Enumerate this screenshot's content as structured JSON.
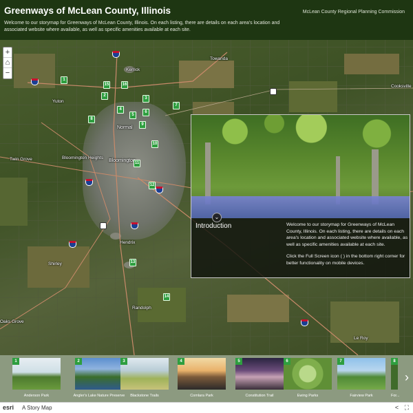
{
  "header": {
    "title": "Greenways of McLean County, Illinois",
    "description": "Welcome to our storymap for Greenways of McLean County, Illinois. On each listing, there are details on each area's location and associated website where available, as well as specific amenities available at each site.",
    "organization": "McLean County Regional Planning Commission"
  },
  "map": {
    "zoom_in": "+",
    "home": "⌂",
    "zoom_out": "−",
    "towns": [
      "Towanda",
      "Kerrick",
      "Normal",
      "Bloomington",
      "Bloomington Heights",
      "Twin Grove",
      "Yuton",
      "Hendrix",
      "Shirley",
      "Randolph",
      "Cooksville",
      "Oaks Grove",
      "Le Roy"
    ],
    "pins": [
      "1",
      "2",
      "3",
      "4",
      "5",
      "6",
      "7",
      "8",
      "9",
      "10",
      "11",
      "12",
      "13",
      "14",
      "15",
      "16"
    ]
  },
  "intro_panel": {
    "title": "Introduction",
    "paragraph1": "Welcome to our storymap for Greenways of McLean County, Illinois. On each listing, there are details on each area's location and associated website where available, as well as specific amenities available at each site.",
    "paragraph2": "Click the Full Screen icon (  ) in the bottom right corner for better functionality on mobile devices.",
    "collapse_icon": "chevron-down-icon"
  },
  "carousel": {
    "items": [
      {
        "num": "1",
        "name": "Anderson Park"
      },
      {
        "num": "2",
        "name": "Angler's Lake Nature Preserve"
      },
      {
        "num": "3",
        "name": "Blackstone Trails"
      },
      {
        "num": "4",
        "name": "Comlara Park"
      },
      {
        "num": "5",
        "name": "Constitution Trail"
      },
      {
        "num": "6",
        "name": "Ewing Parks"
      },
      {
        "num": "7",
        "name": "Fairview Park"
      },
      {
        "num": "8",
        "name": "For..."
      }
    ],
    "next": "›"
  },
  "footer": {
    "logo": "esri",
    "label": "A Story Map",
    "share_icon": "share-icon",
    "fullscreen_icon": "fullscreen-icon"
  },
  "colors": {
    "header_bg": "#1e3612",
    "pin_green": "#2e9e3f",
    "carousel_bg": "#8c9a80"
  }
}
